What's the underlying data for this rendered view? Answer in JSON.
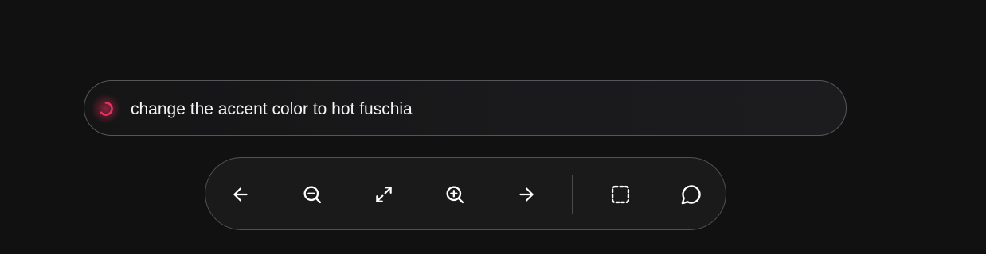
{
  "prompt": {
    "text": "change the accent color to hot fuschia",
    "status_icon": "loading-spinner-icon",
    "spinner_color": "#e8305f"
  },
  "toolbar": {
    "buttons": [
      {
        "name": "back-button",
        "icon": "arrow-left-icon"
      },
      {
        "name": "zoom-out-button",
        "icon": "zoom-out-icon"
      },
      {
        "name": "fit-screen-button",
        "icon": "expand-icon"
      },
      {
        "name": "zoom-in-button",
        "icon": "zoom-in-icon"
      },
      {
        "name": "forward-button",
        "icon": "arrow-right-icon"
      },
      {
        "name": "select-area-button",
        "icon": "dashed-square-icon"
      },
      {
        "name": "comment-button",
        "icon": "chat-bubble-icon"
      }
    ]
  },
  "colors": {
    "background": "#111112",
    "bar_border": "#56565a",
    "icon": "#ffffff",
    "accent": "#e8305f"
  }
}
